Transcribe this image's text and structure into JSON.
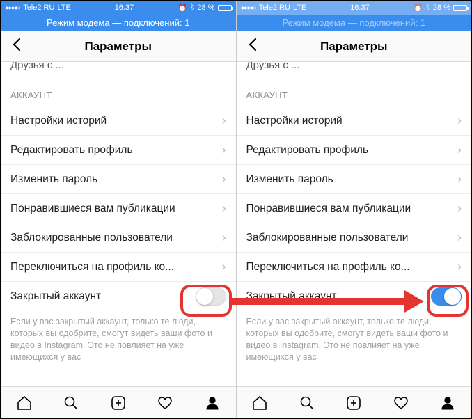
{
  "status": {
    "carrier": "Tele2 RU",
    "network": "LTE",
    "time": "16:37",
    "battery_percent": "28 %"
  },
  "hotspot": "Режим модема — подключений: 1",
  "nav": {
    "title": "Параметры"
  },
  "truncated_prev": "Друзья с ...",
  "section_account": "АККАУНТ",
  "rows": {
    "story_settings": "Настройки историй",
    "edit_profile": "Редактировать профиль",
    "change_password": "Изменить пароль",
    "liked_posts": "Понравившиеся вам публикации",
    "blocked_users": "Заблокированные пользователи",
    "switch_profile": "Переключиться на профиль ко...",
    "private_account": "Закрытый аккаунт"
  },
  "footer_note": "Если у вас закрытый аккаунт, только те люди, которых вы одобрите, смогут видеть ваши фото и видео в Instagram. Это не повлияет на уже имеющихся у вас",
  "toggles": {
    "left_private": false,
    "right_private": true
  },
  "colors": {
    "accent": "#3b8ded",
    "highlight": "#e5342f"
  }
}
